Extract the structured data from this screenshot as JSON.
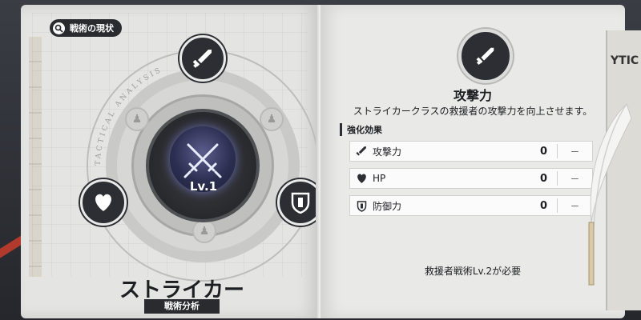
{
  "left_page": {
    "header_badge": "戦術の現状",
    "level_label": "Lv.1",
    "class_name": "ストライカー",
    "class_subtitle": "戦術分析",
    "ring_text": "TACTICAL ANALYSIS"
  },
  "right_page": {
    "skill_name": "攻撃力",
    "skill_description": "ストライカークラスの救援者の攻撃力を向上させます。",
    "section_label": "強化効果",
    "stats": [
      {
        "icon": "sword-icon",
        "name": "攻撃力",
        "value": "0",
        "increase": "－"
      },
      {
        "icon": "heart-icon",
        "name": "HP",
        "value": "0",
        "increase": "－"
      },
      {
        "icon": "shield-icon",
        "name": "防御力",
        "value": "0",
        "increase": "－"
      }
    ],
    "requirement": "救援者戦術Lv.2が必要"
  },
  "newspaper": {
    "headline": "YTIC"
  },
  "colors": {
    "dark": "#2d2e33",
    "paper": "#e6e6e4",
    "emblem_glow": "#5b5e8c"
  }
}
